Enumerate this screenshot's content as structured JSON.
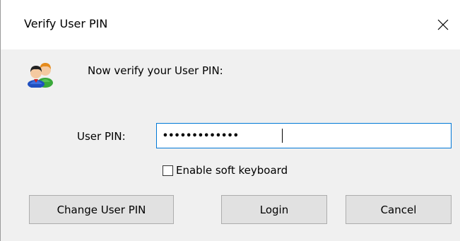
{
  "window": {
    "title": "Verify User PIN"
  },
  "dialog": {
    "icon": "two-users-icon",
    "prompt": "Now verify your User PIN:",
    "pin_label": "User PIN:",
    "pin_value": "•••••••••••••",
    "soft_keyboard_label": "Enable soft keyboard",
    "soft_keyboard_checked": false
  },
  "buttons": {
    "change_pin": "Change User PIN",
    "login": "Login",
    "cancel": "Cancel"
  },
  "colors": {
    "dialog_bg": "#f0f0f0",
    "titlebar_bg": "#ffffff",
    "input_focus_border": "#0078d7",
    "button_bg": "#e1e1e1",
    "button_border": "#adadad"
  }
}
